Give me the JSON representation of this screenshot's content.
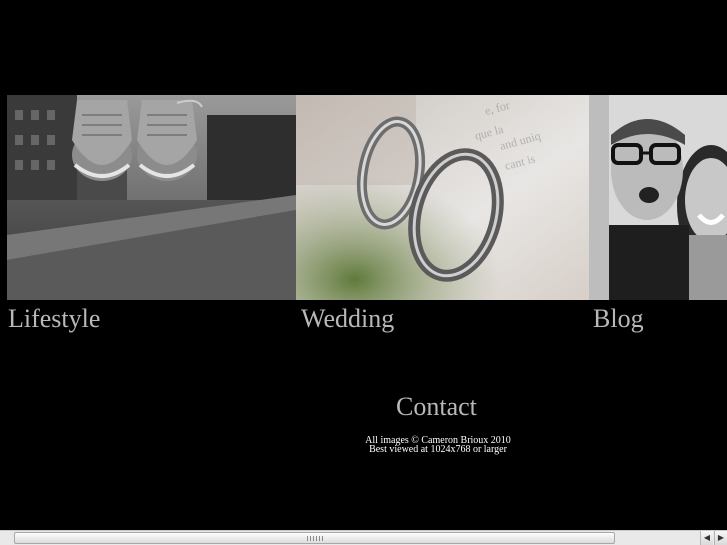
{
  "nav": {
    "lifestyle": "Lifestyle",
    "wedding": "Wedding",
    "blog": "Blog",
    "contact": "Contact"
  },
  "footer": {
    "copyright": "All images © Cameron Brioux 2010",
    "best_viewed": "Best viewed at 1024x768 or larger"
  },
  "scrollbar": {
    "left_arrow_icon": "arrow-left",
    "right_arrow_icon": "arrow-right"
  }
}
